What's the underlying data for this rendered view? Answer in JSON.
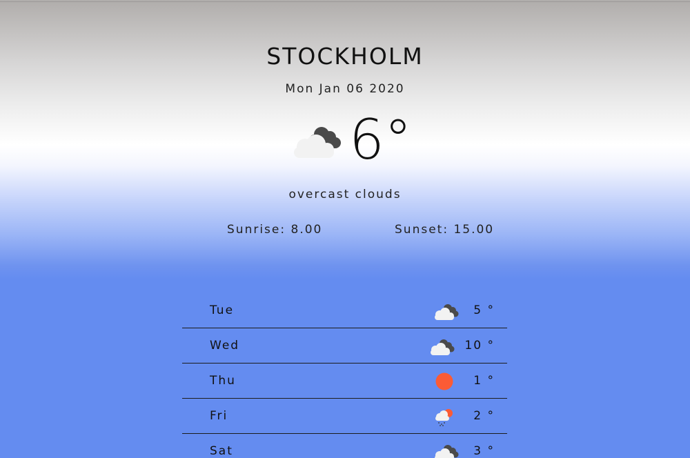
{
  "current": {
    "city": "STOCKHOLM",
    "date": "Mon Jan 06 2020",
    "temperature": "6°",
    "icon": "overcast-clouds-icon",
    "description": "overcast clouds",
    "sunrise": "Sunrise: 8.00",
    "sunset": "Sunset: 15.00"
  },
  "forecast": [
    {
      "day": "Tue",
      "temp": "5 °",
      "icon": "clouds-icon"
    },
    {
      "day": "Wed",
      "temp": "10 °",
      "icon": "clouds-icon"
    },
    {
      "day": "Thu",
      "temp": "1 °",
      "icon": "sun-icon"
    },
    {
      "day": "Fri",
      "temp": "2 °",
      "icon": "snow-sun-icon"
    },
    {
      "day": "Sat",
      "temp": "3 °",
      "icon": "clouds-icon"
    }
  ],
  "colors": {
    "background_top": "#b0adab",
    "background_bottom": "#648cf0",
    "sun": "#fb5b35",
    "cloud_light": "#f2f2f2",
    "cloud_dark": "#4a4a4a"
  }
}
